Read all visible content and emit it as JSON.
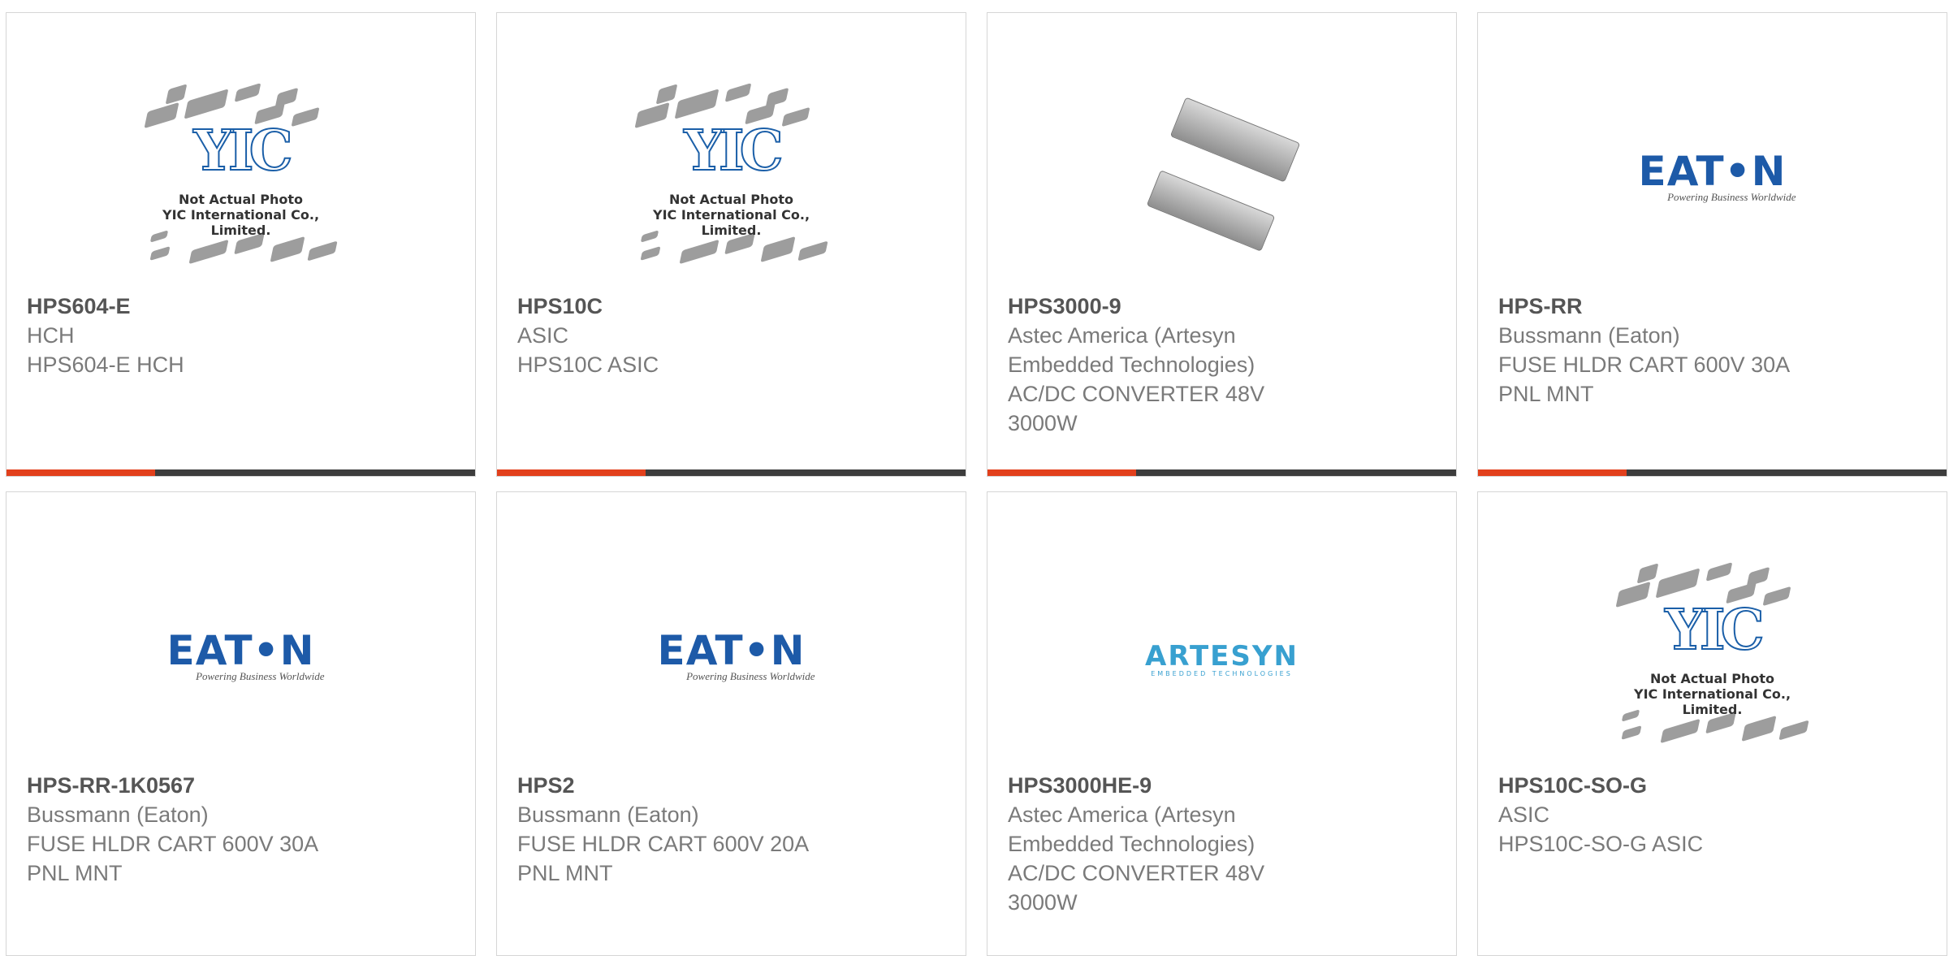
{
  "placeholder": {
    "caption_line1": "Not Actual Photo",
    "caption_line2": "YIC International Co., Limited.",
    "logo": "YIC"
  },
  "eaton_logo": {
    "word": "EAT•N",
    "tagline": "Powering Business Worldwide"
  },
  "artesyn_logo": {
    "word": "ARTESYN",
    "sub": "EMBEDDED TECHNOLOGIES"
  },
  "colors": {
    "accent": "#e2401c",
    "bar": "#3d3d3d",
    "eaton_blue": "#1d5aa8"
  },
  "products": [
    {
      "part": "HPS604-E",
      "lines": [
        "HCH",
        "HPS604-E HCH"
      ],
      "image": "placeholder"
    },
    {
      "part": "HPS10C",
      "lines": [
        "ASIC",
        "HPS10C ASIC"
      ],
      "image": "placeholder"
    },
    {
      "part": "HPS3000-9",
      "lines": [
        "Astec America (Artesyn",
        "Embedded Technologies)",
        "AC/DC CONVERTER 48V",
        "3000W"
      ],
      "image": "psu"
    },
    {
      "part": "HPS-RR",
      "lines": [
        "Bussmann (Eaton)",
        "FUSE HLDR CART 600V 30A",
        "PNL MNT"
      ],
      "image": "eaton"
    },
    {
      "part": "HPS-RR-1K0567",
      "lines": [
        "Bussmann (Eaton)",
        "FUSE HLDR CART 600V 30A",
        "PNL MNT"
      ],
      "image": "eaton"
    },
    {
      "part": "HPS2",
      "lines": [
        "Bussmann (Eaton)",
        "FUSE HLDR CART 600V 20A",
        "PNL MNT"
      ],
      "image": "eaton"
    },
    {
      "part": "HPS3000HE-9",
      "lines": [
        "Astec America (Artesyn",
        "Embedded Technologies)",
        "AC/DC CONVERTER 48V",
        "3000W"
      ],
      "image": "artesyn"
    },
    {
      "part": "HPS10C-SO-G",
      "lines": [
        "ASIC",
        "HPS10C-SO-G ASIC"
      ],
      "image": "placeholder"
    }
  ]
}
